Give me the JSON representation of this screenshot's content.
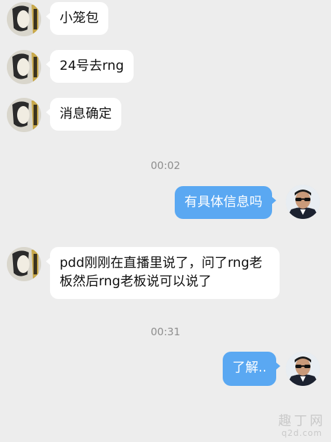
{
  "messages": [
    {
      "side": "in",
      "text": "小笼包"
    },
    {
      "side": "in",
      "text": "24号去rng"
    },
    {
      "side": "in",
      "text": "消息确定"
    },
    {
      "side": "out",
      "text": "有具体信息吗"
    },
    {
      "side": "in",
      "text": "pdd刚刚在直播里说了，问了rng老板然后rng老板说可以说了"
    },
    {
      "side": "out",
      "text": "了解.."
    }
  ],
  "timestamps": [
    "00:02",
    "00:31"
  ],
  "watermark": {
    "cn": "趣丁网",
    "en": "q2d.com"
  },
  "colors": {
    "background": "#ededed",
    "incoming_bubble": "#ffffff",
    "outgoing_bubble": "#5aa8f2",
    "timestamp": "#8e8e8e"
  }
}
